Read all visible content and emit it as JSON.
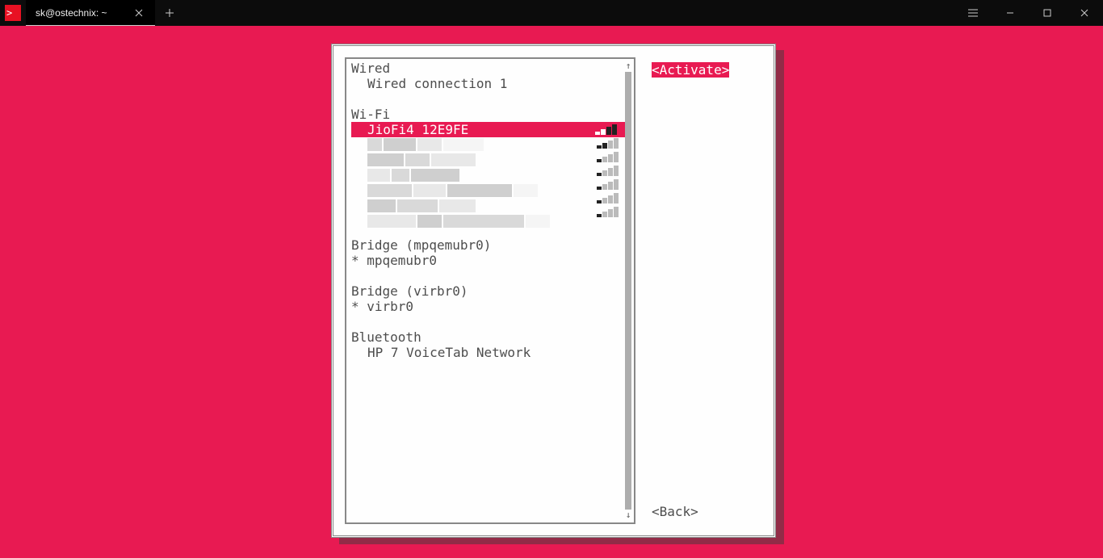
{
  "window": {
    "tab_title": "sk@ostechnix: ~"
  },
  "nmtui": {
    "activate_button": "<Activate>",
    "back_button": "<Back>",
    "sections": {
      "wired": {
        "header": "Wired",
        "items": [
          "Wired connection 1"
        ]
      },
      "wifi": {
        "header": "Wi-Fi",
        "selected": "JioFi4 12E9FE"
      },
      "bridge1": {
        "header": "Bridge (mpqemubr0)",
        "items": [
          "* mpqemubr0"
        ]
      },
      "bridge2": {
        "header": "Bridge (virbr0)",
        "items": [
          "* virbr0"
        ]
      },
      "bluetooth": {
        "header": "Bluetooth",
        "items": [
          "HP 7 VoiceTab Network"
        ]
      }
    }
  }
}
